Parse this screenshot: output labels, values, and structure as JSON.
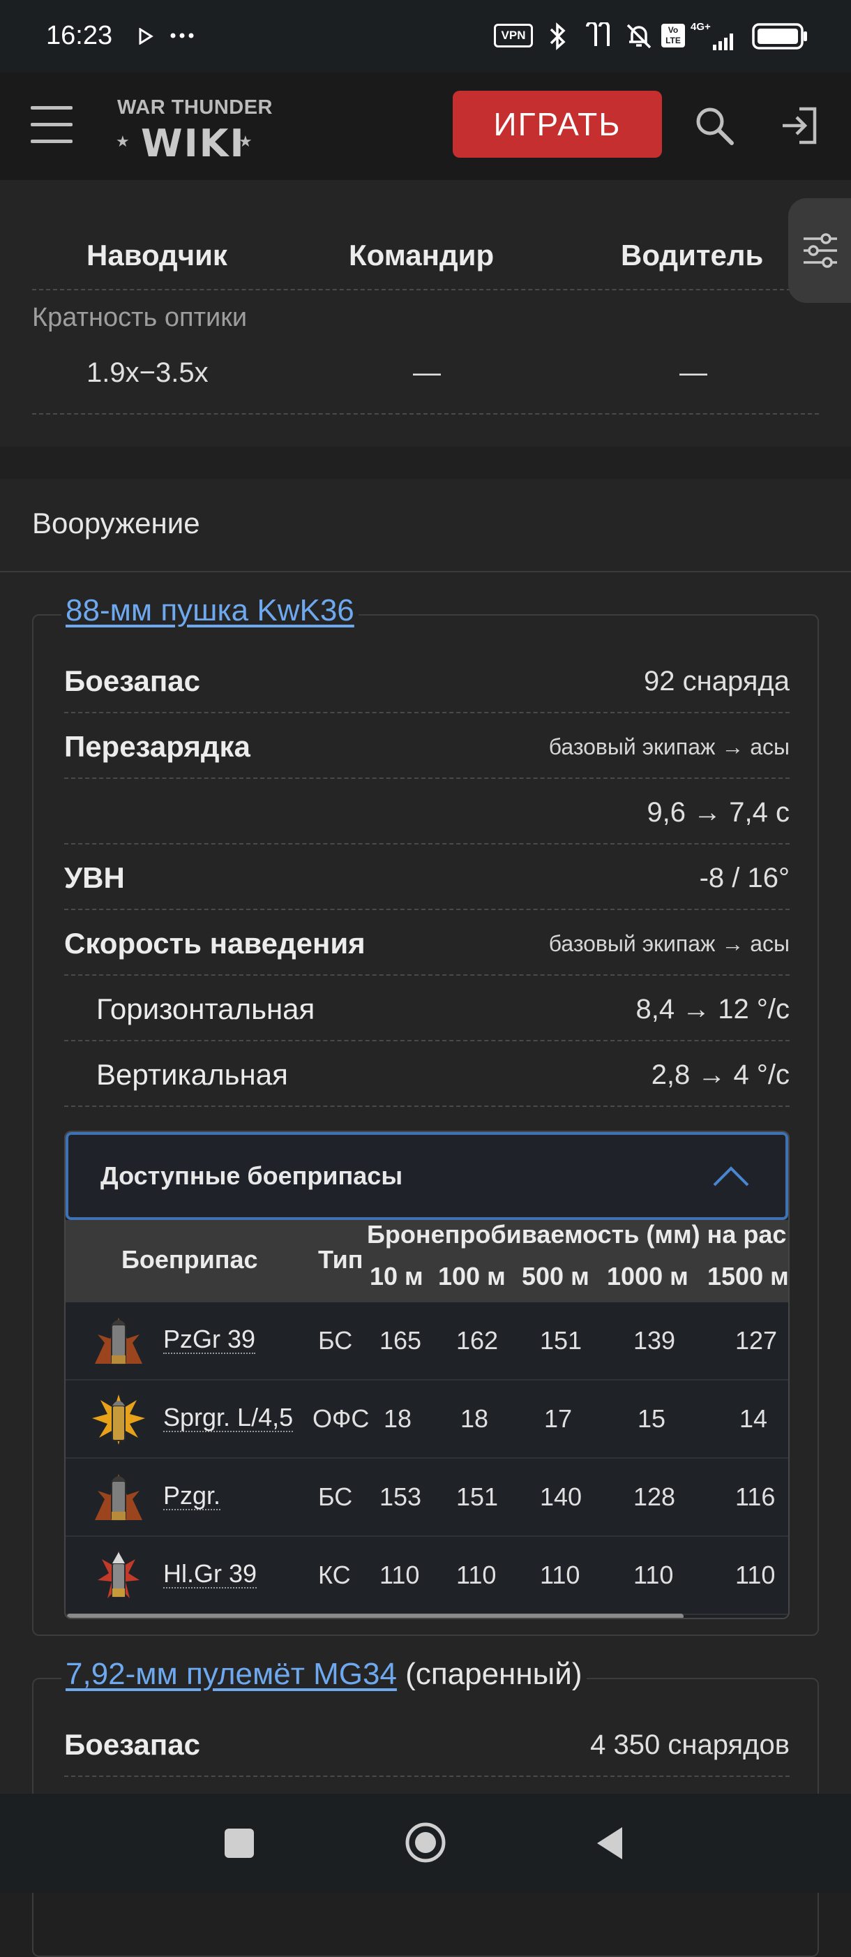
{
  "status_bar": {
    "time": "16:23",
    "icons": [
      "play-icon",
      "more-icon",
      "vpn-icon",
      "bluetooth-icon",
      "earbuds-icon",
      "mute-icon",
      "volte-icon",
      "signal-icon",
      "battery-icon"
    ],
    "vpn_label": "VPN",
    "network_label": "4G+"
  },
  "header": {
    "logo_top": "WAR THUNDER",
    "logo_main": "WIKI",
    "play_label": "ИГРАТЬ"
  },
  "optics": {
    "columns": [
      "Наводчик",
      "Командир",
      "Водитель"
    ],
    "label": "Кратность оптики",
    "values": [
      "1.9x−3.5x",
      "—",
      "—"
    ]
  },
  "armament": {
    "title": "Вооружение",
    "main_gun": {
      "name": "88-мм пушка KwK36",
      "rows": [
        {
          "label": "Боезапас",
          "value": "92 снаряда"
        },
        {
          "label": "Перезарядка",
          "value": "базовый экипаж → асы"
        },
        {
          "label": "",
          "value": "9,6 → 7,4 с"
        },
        {
          "label": "УВН",
          "value": "-8 / 16°"
        },
        {
          "label": "Скорость наведения",
          "value": "базовый экипаж → асы"
        },
        {
          "label": "Горизонтальная",
          "value": "8,4 → 12 °/с"
        },
        {
          "label": "Вертикальная",
          "value": "2,8 → 4 °/с"
        }
      ],
      "ammo": {
        "title": "Доступные боеприпасы",
        "col_ammo": "Боеприпас",
        "col_type": "Тип",
        "col_pen": "Бронепробиваемость (мм) на рас",
        "distances": [
          "10 м",
          "100 м",
          "500 м",
          "1000 м",
          "1500 м"
        ],
        "rows": [
          {
            "name": "PzGr 39",
            "type": "БС",
            "pen": [
              "165",
              "162",
              "151",
              "139",
              "127"
            ]
          },
          {
            "name": "Sprgr. L/4,5",
            "type": "ОФС",
            "pen": [
              "18",
              "18",
              "17",
              "15",
              "14"
            ]
          },
          {
            "name": "Pzgr.",
            "type": "БС",
            "pen": [
              "153",
              "151",
              "140",
              "128",
              "116"
            ]
          },
          {
            "name": "Hl.Gr 39",
            "type": "КС",
            "pen": [
              "110",
              "110",
              "110",
              "110",
              "110"
            ]
          }
        ]
      }
    },
    "mg": {
      "name": "7,92-мм пулемёт MG34",
      "suffix": " (спаренный)",
      "rows": [
        {
          "label": "Боезапас",
          "value": "4 350 снарядов"
        }
      ]
    }
  },
  "nav_bar": {
    "buttons": [
      "recents-button",
      "home-button",
      "back-button"
    ]
  }
}
